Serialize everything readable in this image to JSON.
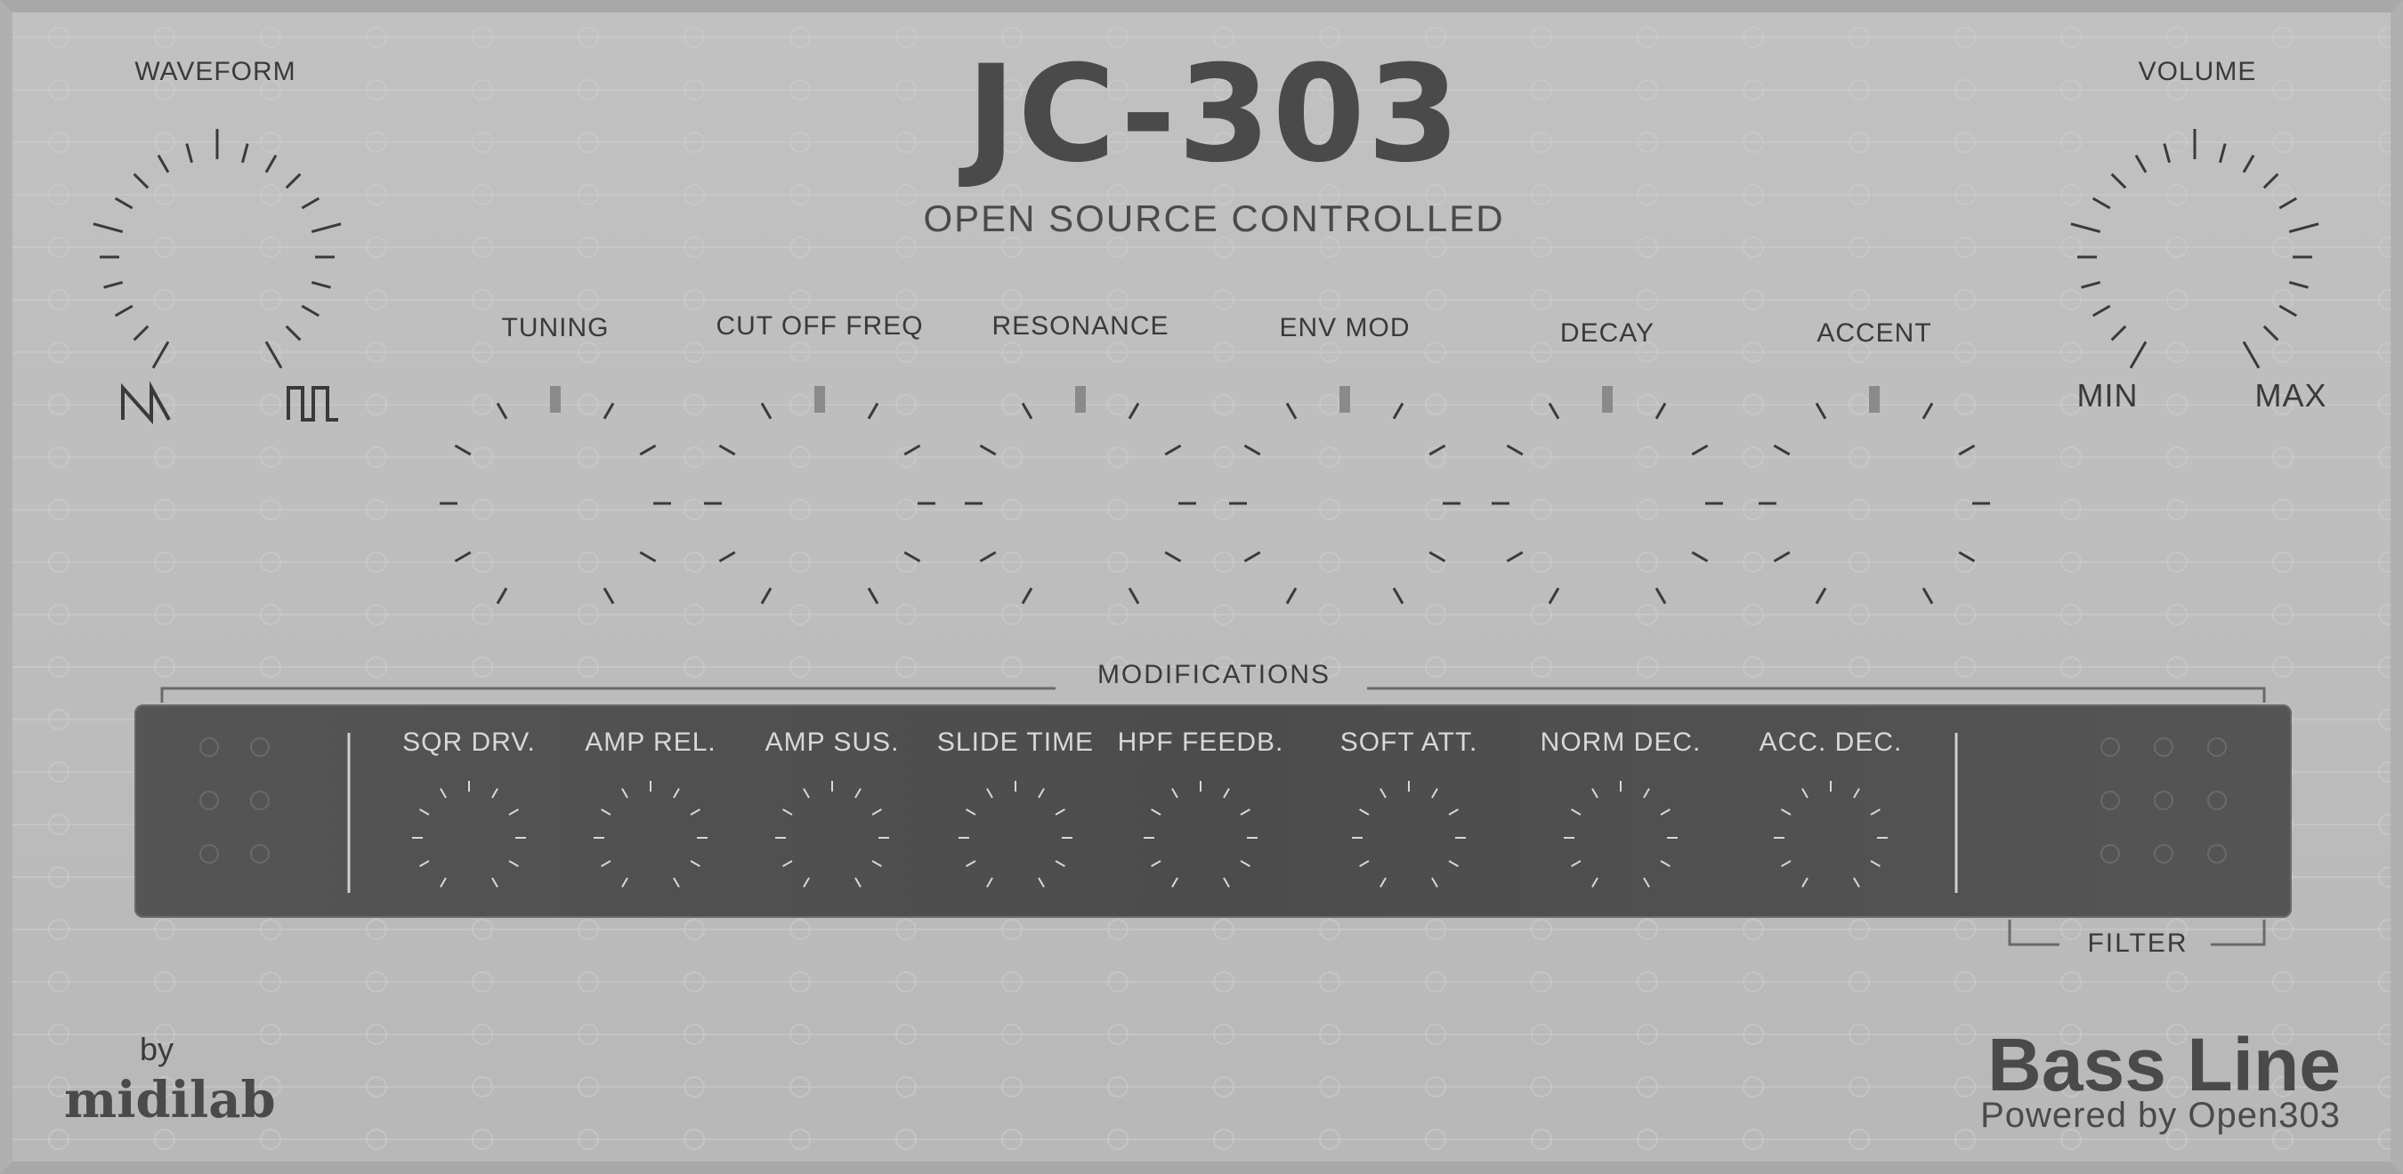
{
  "header": {
    "logo": "JC-303",
    "subtitle": "OPEN SOURCE CONTROLLED"
  },
  "waveform": {
    "label": "WAVEFORM",
    "left_icon": "sawtooth-wave-icon",
    "right_icon": "square-wave-icon"
  },
  "volume": {
    "label": "VOLUME",
    "min_label": "MIN",
    "max_label": "MAX"
  },
  "main_knobs": [
    {
      "label": "TUNING"
    },
    {
      "label": "CUT OFF FREQ"
    },
    {
      "label": "RESONANCE"
    },
    {
      "label": "ENV MOD"
    },
    {
      "label": "DECAY"
    },
    {
      "label": "ACCENT"
    }
  ],
  "modifications": {
    "title": "MODIFICATIONS",
    "knobs": [
      {
        "label": "SQR DRV."
      },
      {
        "label": "AMP REL."
      },
      {
        "label": "AMP SUS."
      },
      {
        "label": "SLIDE TIME"
      },
      {
        "label": "HPF FEEDB."
      },
      {
        "label": "SOFT ATT."
      },
      {
        "label": "NORM DEC."
      },
      {
        "label": "ACC. DEC."
      }
    ],
    "filter_label": "FILTER"
  },
  "footer": {
    "by": "by",
    "brand": "midilab",
    "product": "Bass Line",
    "powered": "Powered by Open303"
  },
  "colors": {
    "panel": "#bfbfbf",
    "text": "#3a3a3a",
    "mod_panel": "#505050",
    "mod_text": "#d8d8d8",
    "indicator": "#8a8a8a"
  }
}
